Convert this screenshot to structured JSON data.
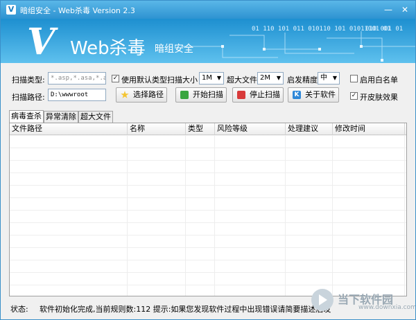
{
  "window": {
    "title": "暗组安全 - Web杀毒  Version 2.3",
    "minimize_glyph": "—",
    "close_glyph": "✕"
  },
  "banner": {
    "logo_v": "V",
    "logo_web": "Web杀毒",
    "logo_sub": "暗组安全",
    "binary_1": "01  110  101  011  010110  101  01011101  01",
    "binary_2": "010  001  01"
  },
  "controls": {
    "scan_type_label": "扫描类型:",
    "scan_type_value": "*.asp,*.asa,*.a:",
    "use_default_type_label": "使用默认类型",
    "use_default_type_checked": true,
    "scan_size_label": "扫描大小",
    "scan_size_value": "1M",
    "max_file_label": "超大文件",
    "max_file_value": "2M",
    "heuristic_label": "启发精度",
    "heuristic_value": "中",
    "whitelist_label": "启用白名单",
    "whitelist_checked": false,
    "scan_path_label": "扫描路径:",
    "scan_path_value": "D:\\wwwroot",
    "skin_label": "开皮肤效果",
    "skin_checked": true
  },
  "buttons": {
    "choose_path": "选择路径",
    "start_scan": "开始扫描",
    "stop_scan": "停止扫描",
    "about": "关于软件"
  },
  "tabs": [
    {
      "label": "病毒查杀",
      "active": true
    },
    {
      "label": "异常清除",
      "active": false
    },
    {
      "label": "超大文件",
      "active": false
    }
  ],
  "table": {
    "columns": [
      "文件路径",
      "名称",
      "类型",
      "风险等级",
      "处理建议",
      "修改时间"
    ],
    "rows": []
  },
  "status": {
    "label": "状态:",
    "text": "软件初始化完成,当前规则数:112 提示:如果您发现软件过程中出现错误请简要描述后发至new4@darkst.com"
  },
  "watermark": {
    "text": "当下软件园",
    "url": "www.downxia.com"
  }
}
